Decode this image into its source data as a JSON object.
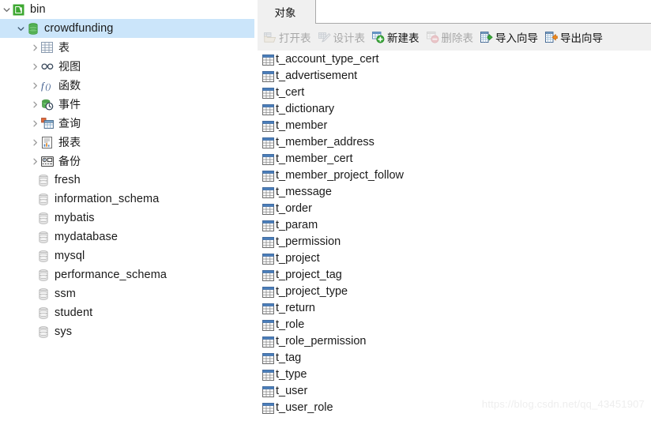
{
  "colors": {
    "selection": "#cbe5fa",
    "toolbar_bg": "#f0f0f0",
    "panel_bg": "#ffffff",
    "text": "#1a1a1a",
    "disabled_text": "#a8a8a8",
    "table_icon_header": "#4a7ebb",
    "db_green": "#4caf50",
    "watermark": "#eeeeee"
  },
  "sidebar": {
    "root": {
      "label": "bin",
      "icon": "navicat-connection-icon",
      "expanded": true
    },
    "database": {
      "label": "crowdfunding",
      "icon": "database-icon",
      "expanded": true,
      "selected": true
    },
    "groups": [
      {
        "label": "表",
        "icon": "table-group-icon",
        "expanded": false
      },
      {
        "label": "视图",
        "icon": "view-group-icon",
        "expanded": false
      },
      {
        "label": "函数",
        "icon": "function-group-icon",
        "expanded": false
      },
      {
        "label": "事件",
        "icon": "event-group-icon",
        "expanded": false
      },
      {
        "label": "查询",
        "icon": "query-group-icon",
        "expanded": false
      },
      {
        "label": "报表",
        "icon": "report-group-icon",
        "expanded": false
      },
      {
        "label": "备份",
        "icon": "backup-group-icon",
        "expanded": false
      }
    ],
    "other_databases": [
      {
        "label": "fresh",
        "icon": "database-icon"
      },
      {
        "label": "information_schema",
        "icon": "database-icon"
      },
      {
        "label": "mybatis",
        "icon": "database-icon"
      },
      {
        "label": "mydatabase",
        "icon": "database-icon"
      },
      {
        "label": "mysql",
        "icon": "database-icon"
      },
      {
        "label": "performance_schema",
        "icon": "database-icon"
      },
      {
        "label": "ssm",
        "icon": "database-icon"
      },
      {
        "label": "student",
        "icon": "database-icon"
      },
      {
        "label": "sys",
        "icon": "database-icon"
      }
    ]
  },
  "right_panel": {
    "tab": {
      "label": "对象",
      "active": true
    },
    "toolbar": [
      {
        "label": "打开表",
        "icon": "open-table-icon",
        "enabled": false
      },
      {
        "label": "设计表",
        "icon": "design-table-icon",
        "enabled": false
      },
      {
        "label": "新建表",
        "icon": "new-table-icon",
        "enabled": true
      },
      {
        "label": "删除表",
        "icon": "delete-table-icon",
        "enabled": false
      },
      {
        "label": "导入向导",
        "icon": "import-wizard-icon",
        "enabled": true
      },
      {
        "label": "导出向导",
        "icon": "export-wizard-icon",
        "enabled": true
      }
    ],
    "tables": [
      "t_account_type_cert",
      "t_advertisement",
      "t_cert",
      "t_dictionary",
      "t_member",
      "t_member_address",
      "t_member_cert",
      "t_member_project_follow",
      "t_message",
      "t_order",
      "t_param",
      "t_permission",
      "t_project",
      "t_project_tag",
      "t_project_type",
      "t_return",
      "t_role",
      "t_role_permission",
      "t_tag",
      "t_type",
      "t_user",
      "t_user_role"
    ]
  },
  "watermark": "https://blog.csdn.net/qq_43451907"
}
